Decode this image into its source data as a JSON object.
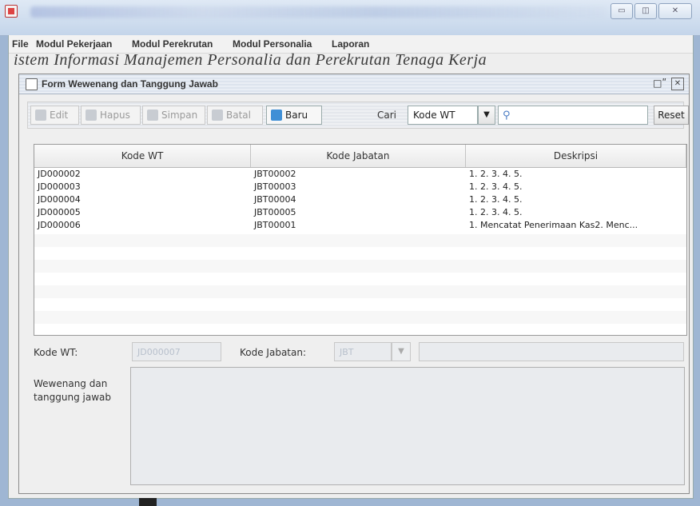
{
  "menubar": {
    "items": [
      "File",
      "Modul Pekerjaan",
      "Modul Perekrutan",
      "Modul Personalia",
      "Laporan"
    ]
  },
  "banner_text": "istem Informasi Manajemen Personalia dan Perekrutan Tenaga Kerja",
  "frame": {
    "title": "Form Wewenang dan Tanggung Jawab",
    "restore_glyph": "□ʺ"
  },
  "toolbar": {
    "edit": "Edit",
    "hapus": "Hapus",
    "simpan": "Simpan",
    "batal": "Batal",
    "baru": "Baru",
    "cari_label": "Cari",
    "search_field_selected": "Kode WT",
    "reset": "Reset"
  },
  "table": {
    "headers": [
      "Kode WT",
      "Kode Jabatan",
      "Deskripsi"
    ],
    "rows": [
      [
        "JD000002",
        "JBT00002",
        "1. 2. 3. 4. 5."
      ],
      [
        "JD000003",
        "JBT00003",
        "1. 2. 3. 4. 5."
      ],
      [
        "JD000004",
        "JBT00004",
        "1. 2. 3. 4. 5."
      ],
      [
        "JD000005",
        "JBT00005",
        "1. 2. 3. 4. 5."
      ],
      [
        "JD000006",
        "JBT00001",
        "1. Mencatat Penerimaan Kas2. Menc..."
      ]
    ]
  },
  "form": {
    "kode_wt_label": "Kode WT:",
    "kode_wt_value": "JD000007",
    "kode_jabatan_label": "Kode Jabatan:",
    "kode_jabatan_value": "JBT",
    "wewenang_label_1": "Wewenang dan",
    "wewenang_label_2": "tanggung jawab"
  },
  "colors": {
    "accent": "#3f8fd6",
    "disabled_text": "#b8c0cc"
  }
}
